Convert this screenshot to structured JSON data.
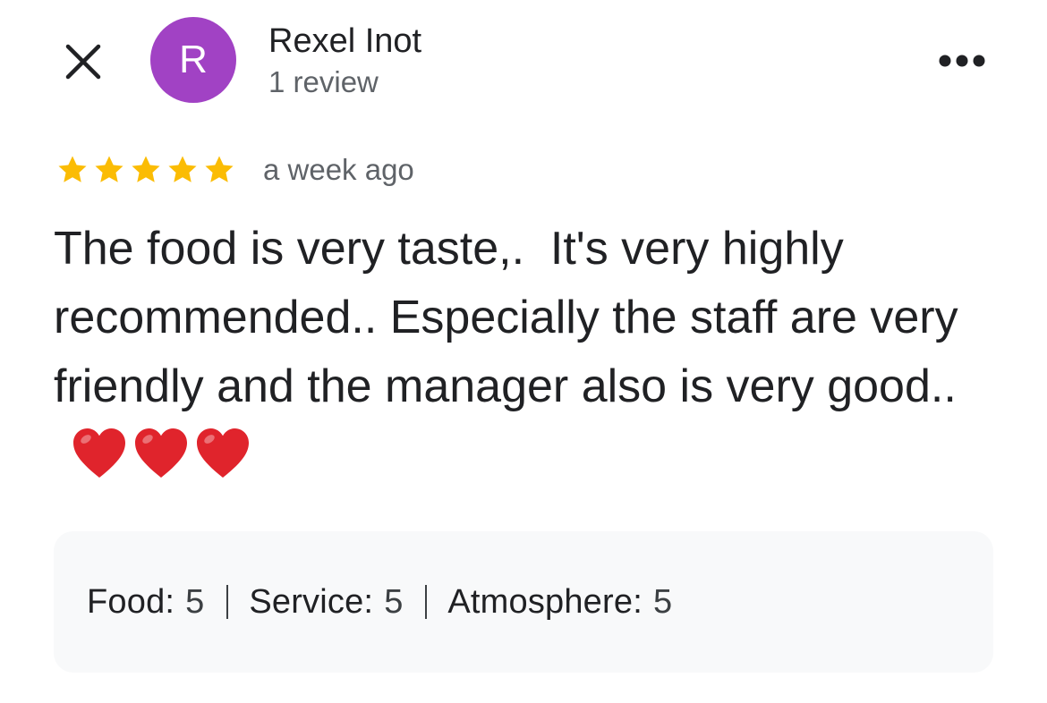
{
  "reviewer": {
    "initial": "R",
    "name": "Rexel Inot",
    "review_count": "1 review",
    "avatar_color": "#a142c4"
  },
  "review": {
    "rating": 5,
    "max_rating": 5,
    "time": "a week ago",
    "text": "The food is very taste,.  It's very highly recommended.. Especially the staff are very friendly and the manager also is very good..",
    "emoji": [
      "heart",
      "heart",
      "heart"
    ],
    "star_color": "#fbbc04",
    "heart_color": "#e0242c"
  },
  "ratings": [
    {
      "label": "Food:",
      "value": "5"
    },
    {
      "label": "Service:",
      "value": "5"
    },
    {
      "label": "Atmosphere:",
      "value": "5"
    }
  ],
  "icons": {
    "close": "close-icon",
    "more": "more-horizontal-icon"
  }
}
